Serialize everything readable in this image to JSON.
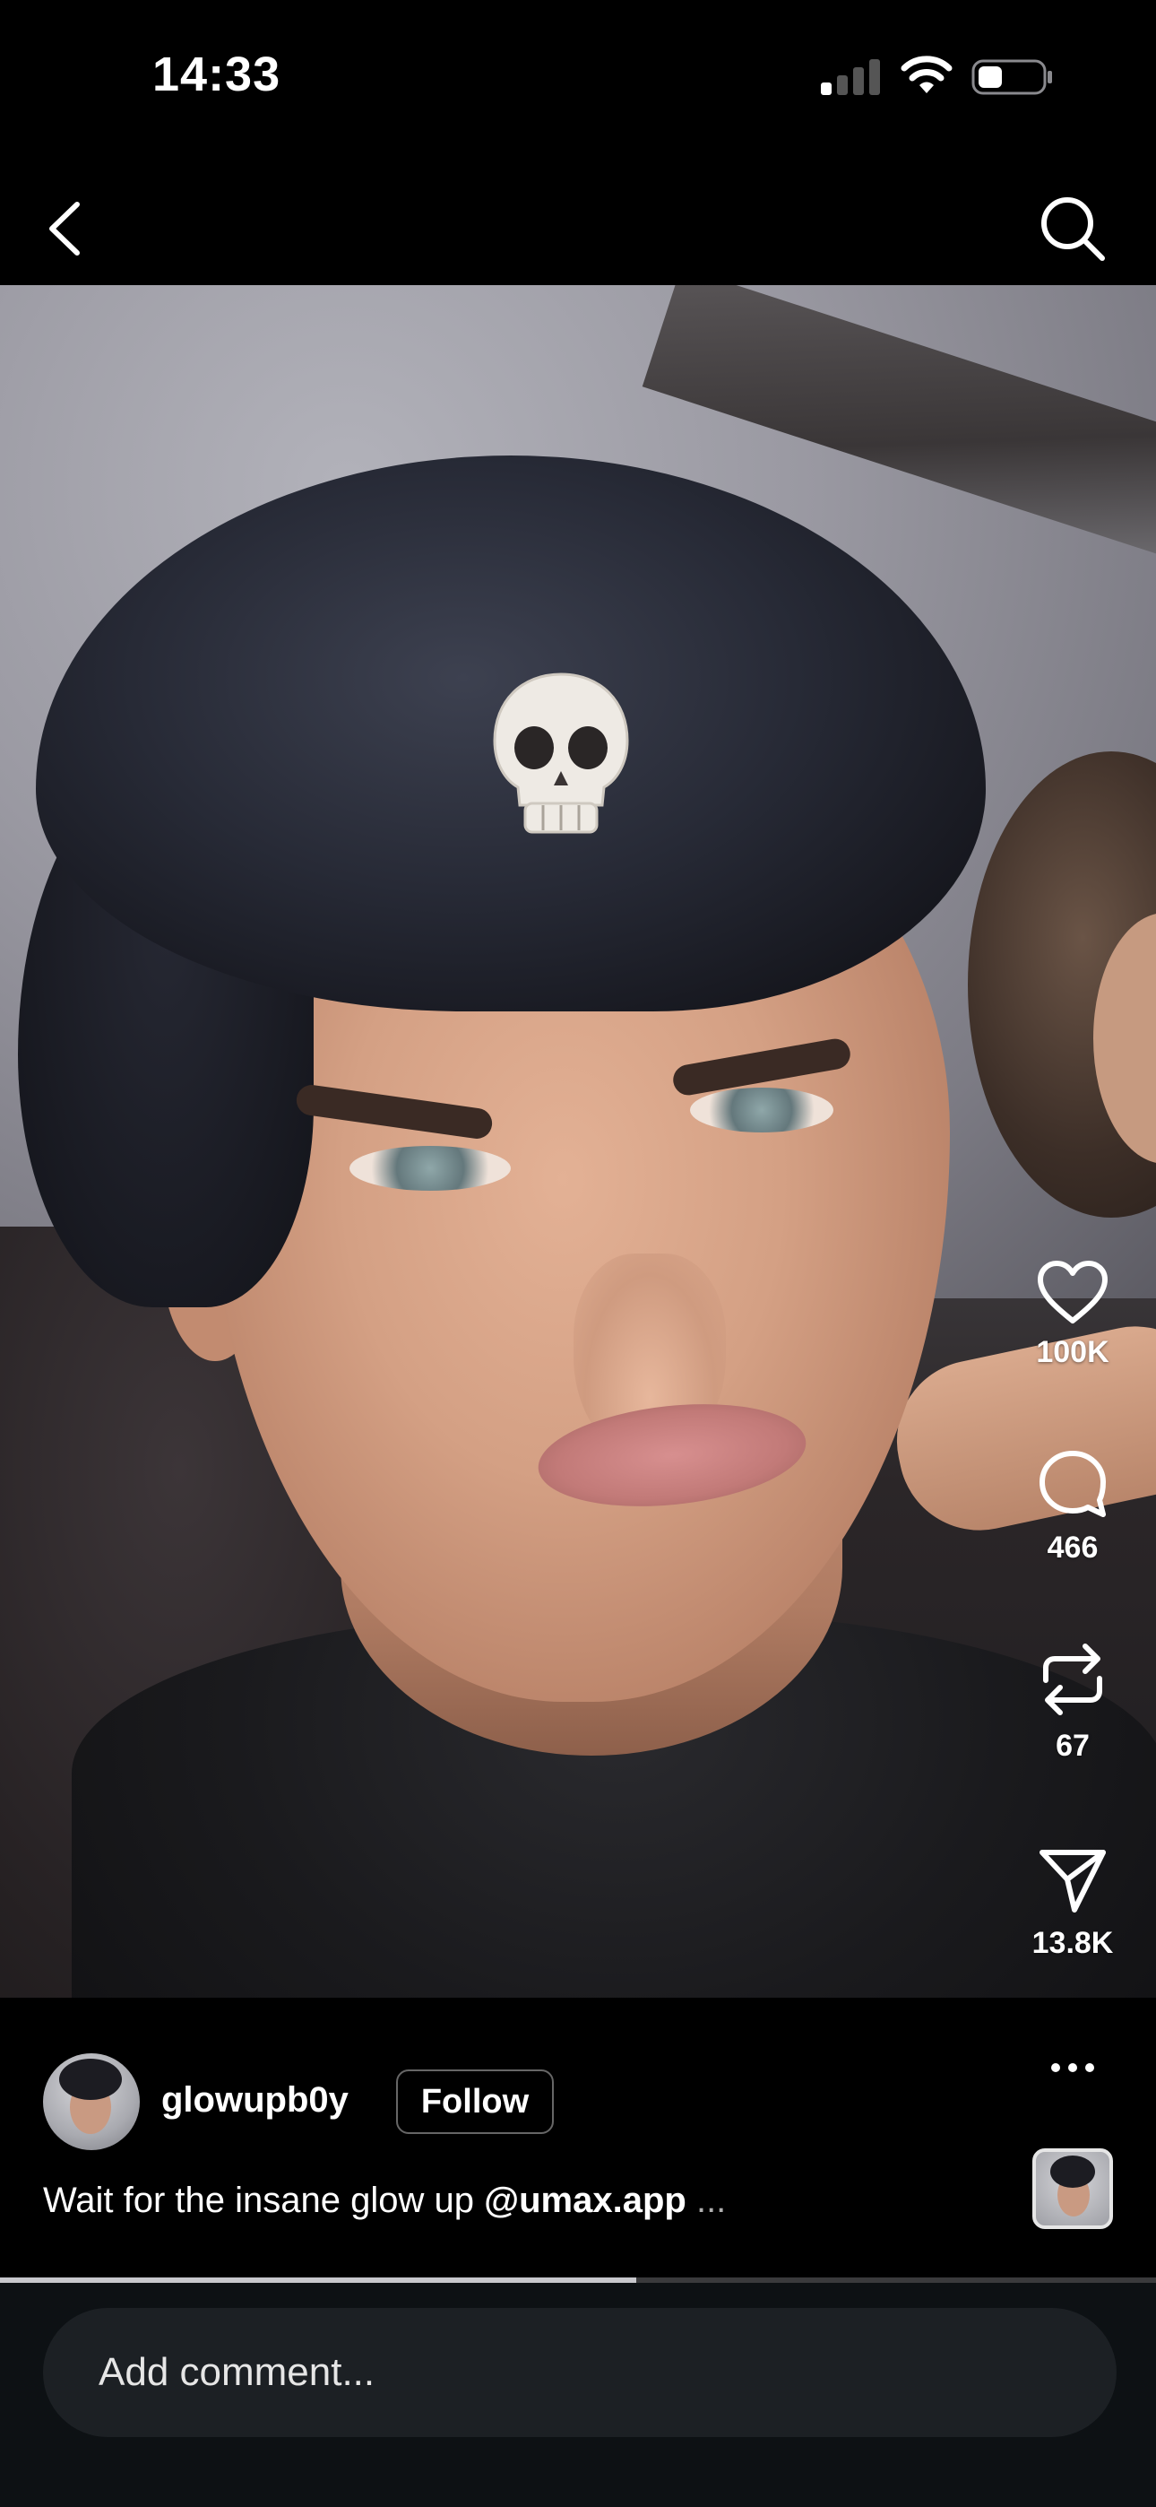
{
  "status_bar": {
    "time": "14:33",
    "icons": [
      "cellular-signal-icon",
      "wifi-icon",
      "battery-icon"
    ]
  },
  "nav": {
    "back_icon": "chevron-left-icon",
    "search_icon": "search-icon"
  },
  "media": {
    "sticker": "💀"
  },
  "actions": {
    "like_count": "100K",
    "comment_count": "466",
    "repost_count": "67",
    "share_count": "13.8K"
  },
  "post": {
    "username": "glowupb0y",
    "follow_label": "Follow",
    "caption_text": "Wait for the insane glow up ",
    "caption_mention": "@umax.app",
    "caption_more": " ..."
  },
  "progress": {
    "fraction": 0.55
  },
  "comment": {
    "placeholder": "Add comment..."
  },
  "colors": {
    "background": "#000000",
    "comment_bar": "#0d1114",
    "comment_input": "#1c2024",
    "text": "#ffffff"
  }
}
